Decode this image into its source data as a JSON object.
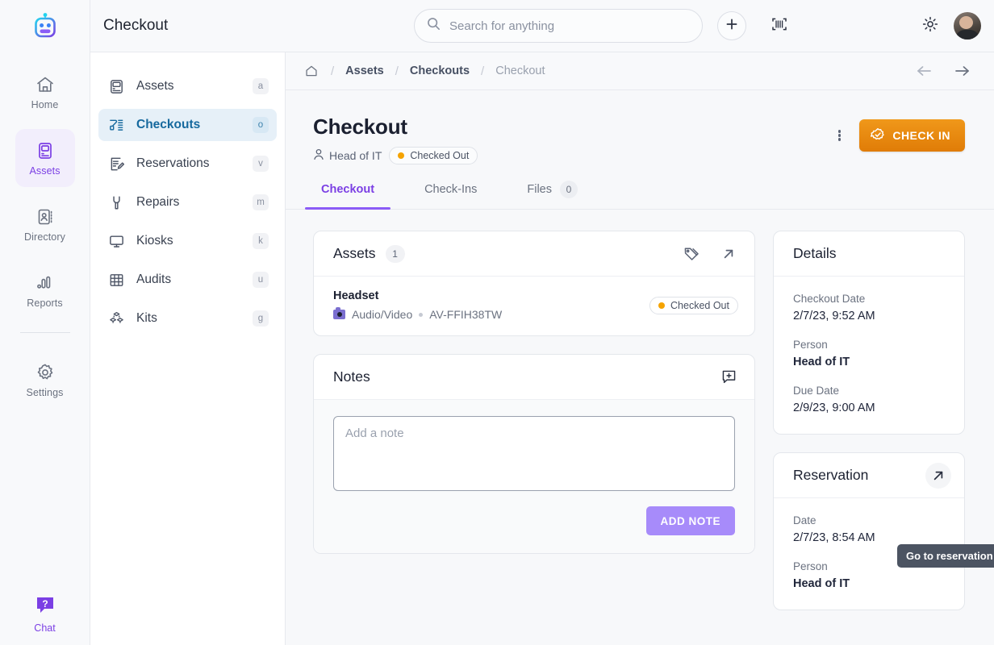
{
  "app": {
    "logo_icon": "robot-logo-icon",
    "brand_gradient": [
      "#22d3ee",
      "#7b3fe4"
    ]
  },
  "rail": {
    "items": [
      {
        "label": "Home",
        "icon": "home-icon",
        "active": false
      },
      {
        "label": "Assets",
        "icon": "assets-monitor-icon",
        "active": true
      },
      {
        "label": "Directory",
        "icon": "directory-card-icon",
        "active": false
      },
      {
        "label": "Reports",
        "icon": "reports-bars-icon",
        "active": false
      },
      {
        "label": "Settings",
        "icon": "gear-icon",
        "active": false
      }
    ],
    "chat": {
      "label": "Chat",
      "icon": "chat-question-icon"
    }
  },
  "topbar": {
    "title": "Checkout",
    "search": {
      "placeholder": "Search for anything",
      "value": "",
      "icon": "search-icon"
    },
    "add_button_icon": "plus-icon",
    "barcode_button_icon": "barcode-scan-icon",
    "theme_toggle_icon": "sun-icon",
    "avatar_icon": "user-avatar"
  },
  "nav": {
    "header": "Checkout",
    "items": [
      {
        "label": "Assets",
        "key": "a",
        "icon": "assets-monitor-icon",
        "active": false
      },
      {
        "label": "Checkouts",
        "key": "o",
        "icon": "checkout-scanner-icon",
        "active": true
      },
      {
        "label": "Reservations",
        "key": "v",
        "icon": "reservation-edit-icon",
        "active": false
      },
      {
        "label": "Repairs",
        "key": "m",
        "icon": "wrench-icon",
        "active": false
      },
      {
        "label": "Kiosks",
        "key": "k",
        "icon": "kiosk-monitor-icon",
        "active": false
      },
      {
        "label": "Audits",
        "key": "u",
        "icon": "audit-grid-icon",
        "active": false
      },
      {
        "label": "Kits",
        "key": "g",
        "icon": "kits-cubes-icon",
        "active": false
      }
    ]
  },
  "breadcrumb": {
    "home_icon": "home-outline-icon",
    "items": [
      {
        "label": "Assets",
        "muted": false
      },
      {
        "label": "Checkouts",
        "muted": false
      },
      {
        "label": "Checkout",
        "muted": true
      }
    ],
    "separator": "/",
    "back_icon": "arrow-left-icon",
    "forward_icon": "arrow-right-icon"
  },
  "page": {
    "title": "Checkout",
    "person_icon": "person-icon",
    "person": "Head of IT",
    "status": {
      "label": "Checked Out",
      "dot_color": "#f5a301"
    },
    "kebab_icon": "more-vertical-icon",
    "primary_action": {
      "label": "CHECK IN",
      "icon": "check-badge-icon",
      "color": "#e48208"
    }
  },
  "tabs": [
    {
      "label": "Checkout",
      "active": true,
      "count": null
    },
    {
      "label": "Check-Ins",
      "active": false,
      "count": null
    },
    {
      "label": "Files",
      "active": false,
      "count": "0"
    }
  ],
  "assets_card": {
    "title": "Assets",
    "count": "1",
    "tag_icon": "tags-icon",
    "open_icon": "arrow-up-right-icon",
    "rows": [
      {
        "name": "Headset",
        "category_icon": "camera-emoji-icon",
        "category": "Audio/Video",
        "separator": "•",
        "asset_tag": "AV-FFIH38TW",
        "status": {
          "label": "Checked Out",
          "dot_color": "#f5a301"
        }
      }
    ]
  },
  "notes_card": {
    "title": "Notes",
    "add_icon": "comment-plus-icon",
    "textarea": {
      "placeholder": "Add a note",
      "value": ""
    },
    "submit_label": "ADD NOTE"
  },
  "details_card": {
    "title": "Details",
    "fields": [
      {
        "key": "Checkout Date",
        "value": "2/7/23, 9:52 AM",
        "bold": false
      },
      {
        "key": "Person",
        "value": "Head of IT",
        "bold": true
      },
      {
        "key": "Due Date",
        "value": "2/9/23, 9:00 AM",
        "bold": false
      }
    ]
  },
  "reservation_card": {
    "title": "Reservation",
    "open_icon": "arrow-up-right-icon",
    "tooltip": "Go to reservation",
    "fields": [
      {
        "key": "Date",
        "value": "2/7/23, 8:54 AM",
        "bold": false
      },
      {
        "key": "Person",
        "value": "Head of IT",
        "bold": true
      }
    ]
  },
  "colors": {
    "accent_purple": "#7b3fe4",
    "accent_purple_light": "#a78bfa",
    "accent_blue": "#16699e",
    "status_orange": "#f5a301",
    "button_orange": "#e48208",
    "page_bg": "#f7f8fa",
    "card_border": "#e4e7ec"
  }
}
